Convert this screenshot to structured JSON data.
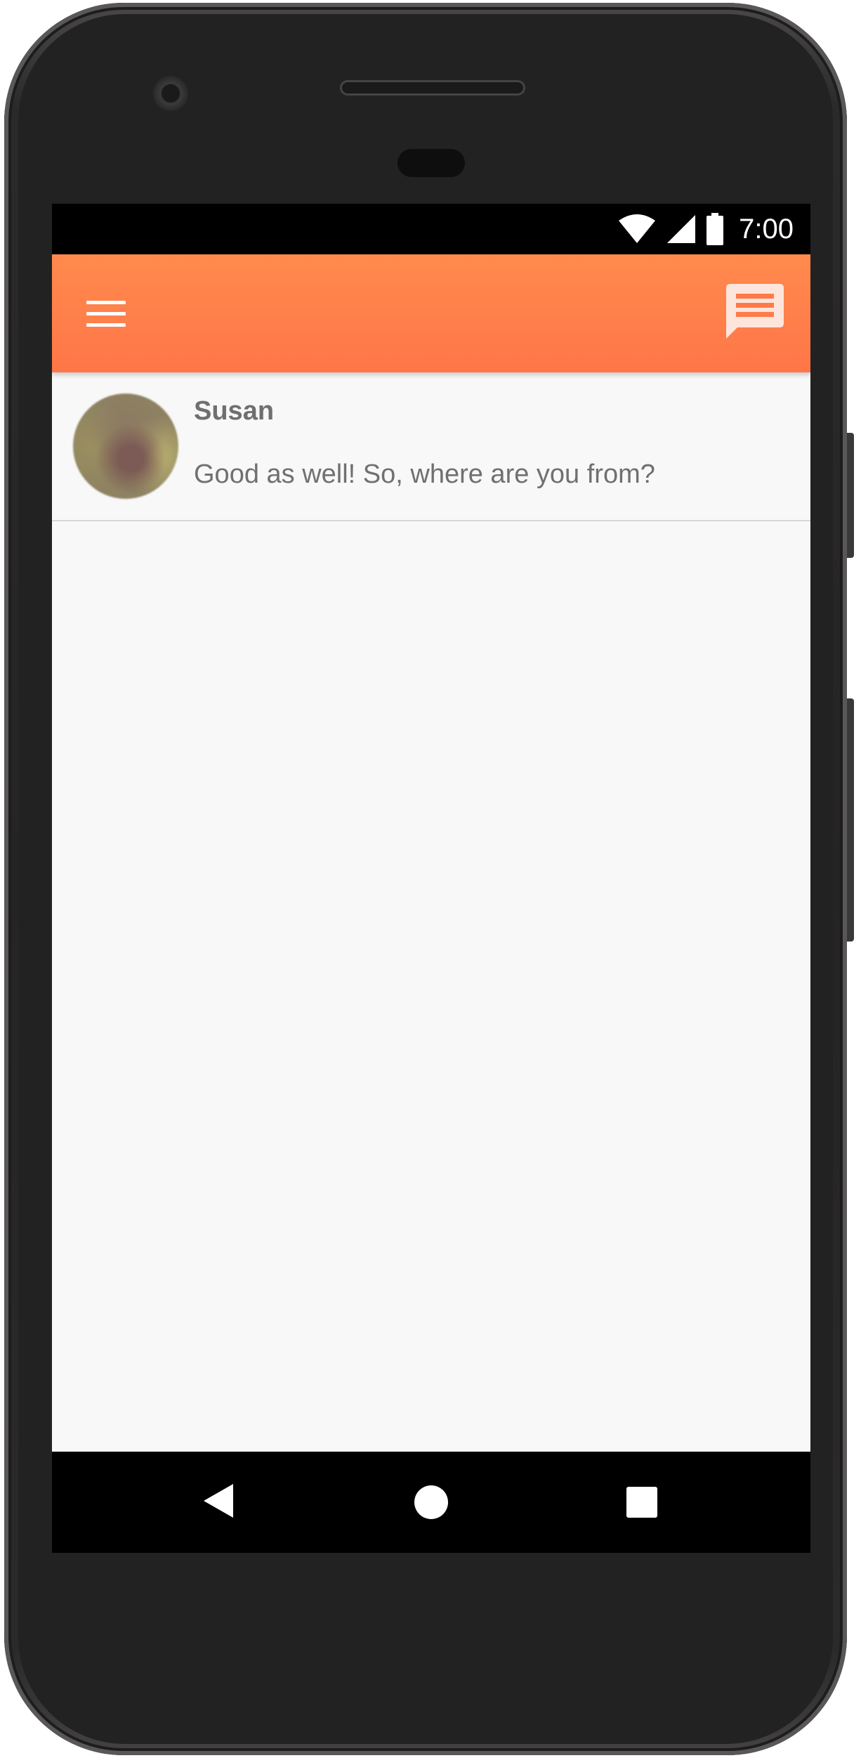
{
  "status_bar": {
    "time": "7:00",
    "icons": [
      "wifi-icon",
      "signal-icon",
      "battery-icon"
    ]
  },
  "toolbar": {
    "menu_icon": "menu-icon",
    "action_icon": "chat-icon",
    "accent_color": "#ff7a48"
  },
  "conversations": [
    {
      "name": "Susan",
      "last_message": "Good as well! So, where are you from?"
    }
  ],
  "nav_bar": {
    "icons": [
      "back-icon",
      "home-icon",
      "recents-icon"
    ]
  }
}
